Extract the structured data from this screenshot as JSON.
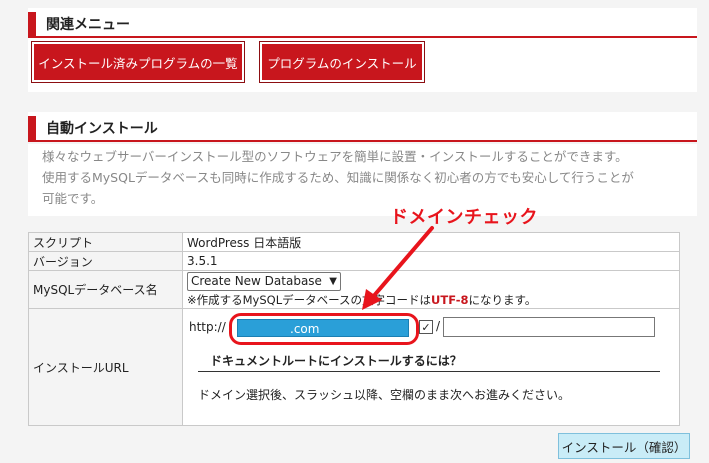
{
  "related_menu": {
    "title": "関連メニュー",
    "buttons": [
      "インストール済みプログラムの一覧",
      "プログラムのインストール"
    ]
  },
  "auto_install": {
    "title": "自動インストール",
    "description_lines": [
      "様々なウェブサーバーインストール型のソフトウェアを簡単に設置・インストールすることができます。",
      "使用するMySQLデータベースも同時に作成するため、知識に関係なく初心者の方でも安心して行うことが",
      "可能です。"
    ]
  },
  "form": {
    "script_label": "スクリプト",
    "script_value": "WordPress 日本語版",
    "version_label": "バージョン",
    "version_value": "3.5.1",
    "db_label": "MySQLデータベース名",
    "db_selected": "Create New Database",
    "db_note_prefix": "※作成するMySQLデータベースの",
    "db_note_mid": "文字コードは",
    "db_note_charset": "UTF-8",
    "db_note_suffix": "になります。",
    "url_label": "インストールURL",
    "url_prefix": "http://",
    "domain_value": ".com",
    "checkbox_mark": "✓",
    "slash": "/",
    "doc_root_heading": "ドキュメントルートにインストールするには？",
    "domain_instruction": "ドメイン選択後、スラッシュ以降、空欄のまま次へお進みください。"
  },
  "annotation": {
    "label": "ドメインチェック"
  },
  "install_button": "インストール（確認）",
  "colors": {
    "accent": "#c8161d",
    "annotation": "#e8141c",
    "domain_highlight": "#2a9fd8"
  }
}
